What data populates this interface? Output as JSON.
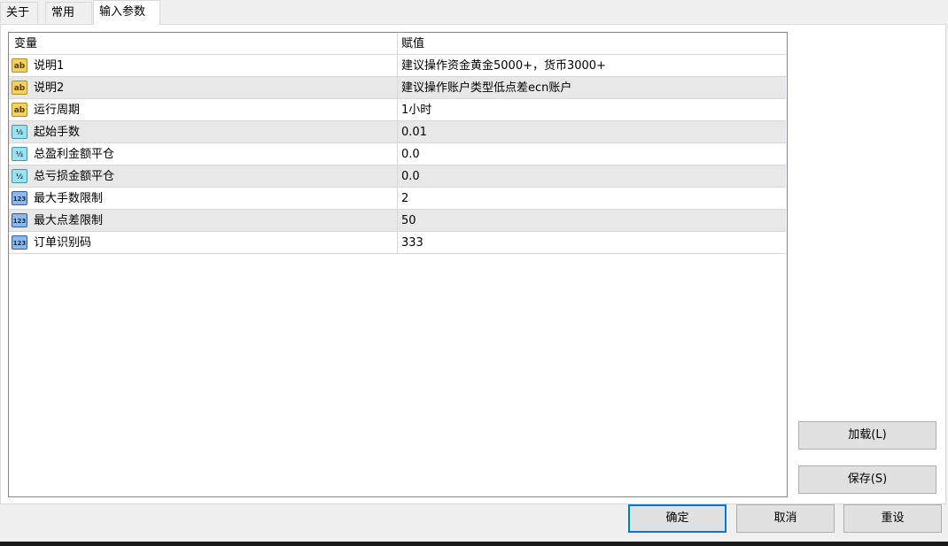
{
  "tabs": [
    {
      "label": "关于"
    },
    {
      "label": "常用"
    },
    {
      "label": "输入参数",
      "active": true
    }
  ],
  "grid": {
    "headers": {
      "variable": "变量",
      "value": "赋值"
    },
    "rows": [
      {
        "icon": "string-type-icon",
        "icon_text": "ab",
        "name": "说明1",
        "value": "建议操作资金黄金5000+，货币3000+"
      },
      {
        "icon": "string-type-icon",
        "icon_text": "ab",
        "name": "说明2",
        "value": "建议操作账户类型低点差ecn账户"
      },
      {
        "icon": "string-type-icon",
        "icon_text": "ab",
        "name": "运行周期",
        "value": "1小时"
      },
      {
        "icon": "double-type-icon",
        "icon_text": "½",
        "name": "起始手数",
        "value": "0.01"
      },
      {
        "icon": "double-type-icon",
        "icon_text": "½",
        "name": "总盈利金额平仓",
        "value": "0.0"
      },
      {
        "icon": "double-type-icon",
        "icon_text": "½",
        "name": "总亏损金额平仓",
        "value": "0.0"
      },
      {
        "icon": "integer-type-icon",
        "icon_text": "123",
        "name": "最大手数限制",
        "value": "2"
      },
      {
        "icon": "integer-type-icon",
        "icon_text": "123",
        "name": "最大点差限制",
        "value": "50"
      },
      {
        "icon": "integer-type-icon",
        "icon_text": "123",
        "name": "订单识别码",
        "value": "333"
      }
    ]
  },
  "side_buttons": {
    "load": "加载(L)",
    "save": "保存(S)"
  },
  "footer_buttons": {
    "ok": "确定",
    "cancel": "取消",
    "reset": "重设"
  },
  "colors": {
    "accent": "#0078d7",
    "row_alt": "#e8e8e8",
    "ab_icon": "#f3d25f",
    "double_icon": "#9fe0ef",
    "int_icon": "#8fb8e6"
  }
}
